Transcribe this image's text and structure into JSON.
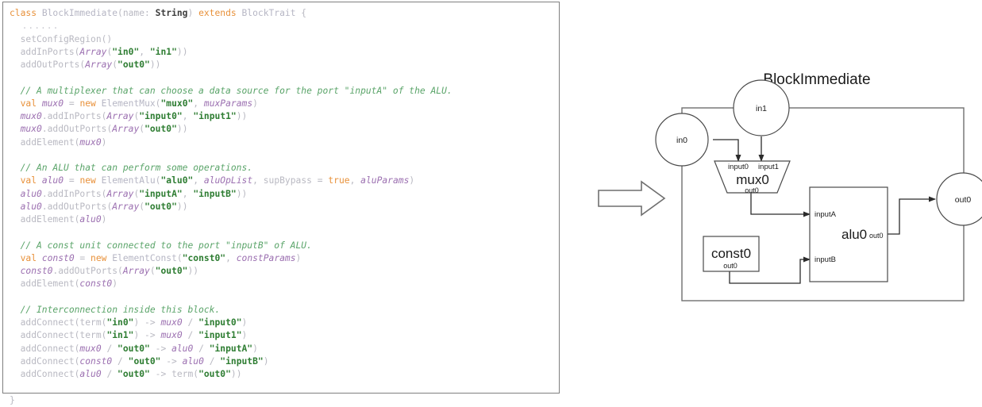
{
  "code_panel": {
    "language": "scala",
    "lines": [
      {
        "tokens": [
          {
            "t": "class ",
            "c": "kw"
          },
          {
            "t": "BlockImmediate",
            "c": "type"
          },
          {
            "t": "(name: ",
            "c": "plain"
          },
          {
            "t": "String",
            "c": "bold"
          },
          {
            "t": ") ",
            "c": "plain"
          },
          {
            "t": "extends ",
            "c": "kw"
          },
          {
            "t": "BlockTrait",
            "c": "type"
          },
          {
            "t": " {",
            "c": "plain"
          }
        ]
      },
      {
        "tokens": [
          {
            "t": "  ......",
            "c": "dots"
          }
        ]
      },
      {
        "tokens": [
          {
            "t": "  setConfigRegion()",
            "c": "plain"
          }
        ]
      },
      {
        "tokens": [
          {
            "t": "  addInPorts(",
            "c": "plain"
          },
          {
            "t": "Array",
            "c": "var"
          },
          {
            "t": "(",
            "c": "plain"
          },
          {
            "t": "\"in0\"",
            "c": "str"
          },
          {
            "t": ", ",
            "c": "plain"
          },
          {
            "t": "\"in1\"",
            "c": "str"
          },
          {
            "t": "))",
            "c": "plain"
          }
        ]
      },
      {
        "tokens": [
          {
            "t": "  addOutPorts(",
            "c": "plain"
          },
          {
            "t": "Array",
            "c": "var"
          },
          {
            "t": "(",
            "c": "plain"
          },
          {
            "t": "\"out0\"",
            "c": "str"
          },
          {
            "t": "))",
            "c": "plain"
          }
        ]
      },
      {
        "tokens": []
      },
      {
        "tokens": [
          {
            "t": "  // A multiplexer that can choose a data source for the port \"inputA\" of the ALU.",
            "c": "cmt"
          }
        ]
      },
      {
        "tokens": [
          {
            "t": "  val ",
            "c": "kw"
          },
          {
            "t": "mux0",
            "c": "var"
          },
          {
            "t": " = ",
            "c": "plain"
          },
          {
            "t": "new ",
            "c": "kw"
          },
          {
            "t": "ElementMux",
            "c": "type"
          },
          {
            "t": "(",
            "c": "plain"
          },
          {
            "t": "\"mux0\"",
            "c": "str"
          },
          {
            "t": ", ",
            "c": "plain"
          },
          {
            "t": "muxParams",
            "c": "var"
          },
          {
            "t": ")",
            "c": "plain"
          }
        ]
      },
      {
        "tokens": [
          {
            "t": "  ",
            "c": "plain"
          },
          {
            "t": "mux0",
            "c": "var"
          },
          {
            "t": ".addInPorts(",
            "c": "plain"
          },
          {
            "t": "Array",
            "c": "var"
          },
          {
            "t": "(",
            "c": "plain"
          },
          {
            "t": "\"input0\"",
            "c": "str"
          },
          {
            "t": ", ",
            "c": "plain"
          },
          {
            "t": "\"input1\"",
            "c": "str"
          },
          {
            "t": "))",
            "c": "plain"
          }
        ]
      },
      {
        "tokens": [
          {
            "t": "  ",
            "c": "plain"
          },
          {
            "t": "mux0",
            "c": "var"
          },
          {
            "t": ".addOutPorts(",
            "c": "plain"
          },
          {
            "t": "Array",
            "c": "var"
          },
          {
            "t": "(",
            "c": "plain"
          },
          {
            "t": "\"out0\"",
            "c": "str"
          },
          {
            "t": "))",
            "c": "plain"
          }
        ]
      },
      {
        "tokens": [
          {
            "t": "  addElement(",
            "c": "plain"
          },
          {
            "t": "mux0",
            "c": "var"
          },
          {
            "t": ")",
            "c": "plain"
          }
        ]
      },
      {
        "tokens": []
      },
      {
        "tokens": [
          {
            "t": "  // An ALU that can perform some operations.",
            "c": "cmt"
          }
        ]
      },
      {
        "tokens": [
          {
            "t": "  val ",
            "c": "kw"
          },
          {
            "t": "alu0",
            "c": "var"
          },
          {
            "t": " = ",
            "c": "plain"
          },
          {
            "t": "new ",
            "c": "kw"
          },
          {
            "t": "ElementAlu",
            "c": "type"
          },
          {
            "t": "(",
            "c": "plain"
          },
          {
            "t": "\"alu0\"",
            "c": "str"
          },
          {
            "t": ", ",
            "c": "plain"
          },
          {
            "t": "aluOpList",
            "c": "var"
          },
          {
            "t": ", supBypass = ",
            "c": "plain"
          },
          {
            "t": "true",
            "c": "kw"
          },
          {
            "t": ", ",
            "c": "plain"
          },
          {
            "t": "aluParams",
            "c": "var"
          },
          {
            "t": ")",
            "c": "plain"
          }
        ]
      },
      {
        "tokens": [
          {
            "t": "  ",
            "c": "plain"
          },
          {
            "t": "alu0",
            "c": "var"
          },
          {
            "t": ".addInPorts(",
            "c": "plain"
          },
          {
            "t": "Array",
            "c": "var"
          },
          {
            "t": "(",
            "c": "plain"
          },
          {
            "t": "\"inputA\"",
            "c": "str"
          },
          {
            "t": ", ",
            "c": "plain"
          },
          {
            "t": "\"inputB\"",
            "c": "str"
          },
          {
            "t": "))",
            "c": "plain"
          }
        ]
      },
      {
        "tokens": [
          {
            "t": "  ",
            "c": "plain"
          },
          {
            "t": "alu0",
            "c": "var"
          },
          {
            "t": ".addOutPorts(",
            "c": "plain"
          },
          {
            "t": "Array",
            "c": "var"
          },
          {
            "t": "(",
            "c": "plain"
          },
          {
            "t": "\"out0\"",
            "c": "str"
          },
          {
            "t": "))",
            "c": "plain"
          }
        ]
      },
      {
        "tokens": [
          {
            "t": "  addElement(",
            "c": "plain"
          },
          {
            "t": "alu0",
            "c": "var"
          },
          {
            "t": ")",
            "c": "plain"
          }
        ]
      },
      {
        "tokens": []
      },
      {
        "tokens": [
          {
            "t": "  // A const unit connected to the port \"inputB\" of ALU.",
            "c": "cmt"
          }
        ]
      },
      {
        "tokens": [
          {
            "t": "  val ",
            "c": "kw"
          },
          {
            "t": "const0",
            "c": "var"
          },
          {
            "t": " = ",
            "c": "plain"
          },
          {
            "t": "new ",
            "c": "kw"
          },
          {
            "t": "ElementConst",
            "c": "type"
          },
          {
            "t": "(",
            "c": "plain"
          },
          {
            "t": "\"const0\"",
            "c": "str"
          },
          {
            "t": ", ",
            "c": "plain"
          },
          {
            "t": "constParams",
            "c": "var"
          },
          {
            "t": ")",
            "c": "plain"
          }
        ]
      },
      {
        "tokens": [
          {
            "t": "  ",
            "c": "plain"
          },
          {
            "t": "const0",
            "c": "var"
          },
          {
            "t": ".addOutPorts(",
            "c": "plain"
          },
          {
            "t": "Array",
            "c": "var"
          },
          {
            "t": "(",
            "c": "plain"
          },
          {
            "t": "\"out0\"",
            "c": "str"
          },
          {
            "t": "))",
            "c": "plain"
          }
        ]
      },
      {
        "tokens": [
          {
            "t": "  addElement(",
            "c": "plain"
          },
          {
            "t": "const0",
            "c": "var"
          },
          {
            "t": ")",
            "c": "plain"
          }
        ]
      },
      {
        "tokens": []
      },
      {
        "tokens": [
          {
            "t": "  // Interconnection inside this block.",
            "c": "cmt"
          }
        ]
      },
      {
        "tokens": [
          {
            "t": "  addConnect(term(",
            "c": "plain"
          },
          {
            "t": "\"in0\"",
            "c": "str"
          },
          {
            "t": ") -> ",
            "c": "plain"
          },
          {
            "t": "mux0",
            "c": "var"
          },
          {
            "t": " / ",
            "c": "plain"
          },
          {
            "t": "\"input0\"",
            "c": "str"
          },
          {
            "t": ")",
            "c": "plain"
          }
        ]
      },
      {
        "tokens": [
          {
            "t": "  addConnect(term(",
            "c": "plain"
          },
          {
            "t": "\"in1\"",
            "c": "str"
          },
          {
            "t": ") -> ",
            "c": "plain"
          },
          {
            "t": "mux0",
            "c": "var"
          },
          {
            "t": " / ",
            "c": "plain"
          },
          {
            "t": "\"input1\"",
            "c": "str"
          },
          {
            "t": ")",
            "c": "plain"
          }
        ]
      },
      {
        "tokens": [
          {
            "t": "  addConnect(",
            "c": "plain"
          },
          {
            "t": "mux0",
            "c": "var"
          },
          {
            "t": " / ",
            "c": "plain"
          },
          {
            "t": "\"out0\"",
            "c": "str"
          },
          {
            "t": " -> ",
            "c": "plain"
          },
          {
            "t": "alu0",
            "c": "var"
          },
          {
            "t": " / ",
            "c": "plain"
          },
          {
            "t": "\"inputA\"",
            "c": "str"
          },
          {
            "t": ")",
            "c": "plain"
          }
        ]
      },
      {
        "tokens": [
          {
            "t": "  addConnect(",
            "c": "plain"
          },
          {
            "t": "const0",
            "c": "var"
          },
          {
            "t": " / ",
            "c": "plain"
          },
          {
            "t": "\"out0\"",
            "c": "str"
          },
          {
            "t": " -> ",
            "c": "plain"
          },
          {
            "t": "alu0",
            "c": "var"
          },
          {
            "t": " / ",
            "c": "plain"
          },
          {
            "t": "\"inputB\"",
            "c": "str"
          },
          {
            "t": ")",
            "c": "plain"
          }
        ]
      },
      {
        "tokens": [
          {
            "t": "  addConnect(",
            "c": "plain"
          },
          {
            "t": "alu0",
            "c": "var"
          },
          {
            "t": " / ",
            "c": "plain"
          },
          {
            "t": "\"out0\"",
            "c": "str"
          },
          {
            "t": " -> term(",
            "c": "plain"
          },
          {
            "t": "\"out0\"",
            "c": "str"
          },
          {
            "t": "))",
            "c": "plain"
          }
        ]
      },
      {
        "tokens": []
      },
      {
        "tokens": [
          {
            "t": "}",
            "c": "plain"
          }
        ]
      }
    ]
  },
  "diagram": {
    "title": "BlockImmediate",
    "ports": {
      "in0": "in0",
      "in1": "in1",
      "out0": "out0"
    },
    "mux": {
      "name": "mux0",
      "in0": "input0",
      "in1": "input1",
      "out": "out0"
    },
    "alu": {
      "name": "alu0",
      "inA": "inputA",
      "inB": "inputB",
      "out": "out0"
    },
    "const": {
      "name": "const0",
      "out": "out0"
    },
    "colors": {
      "wire": "#2b2b2b",
      "outline": "#6f6f6f",
      "shape_stroke": "#4a4a4a",
      "text": "#1a1a1a"
    }
  },
  "flow_arrow": {
    "label": "",
    "direction": "right"
  }
}
